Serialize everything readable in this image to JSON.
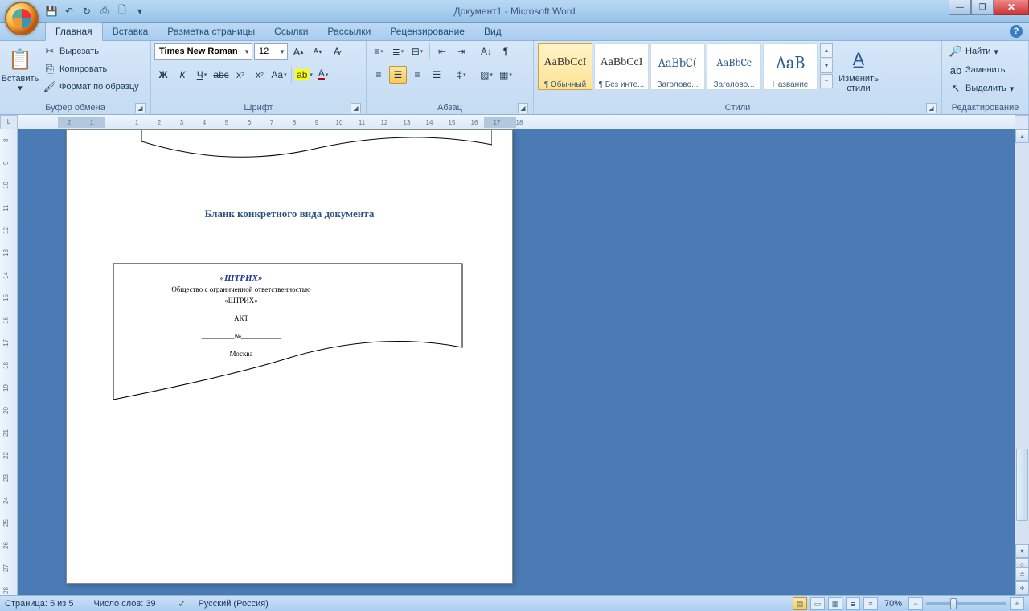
{
  "title": "Документ1 - Microsoft Word",
  "qat": {
    "save": "💾",
    "undo": "↶",
    "redo": "↻",
    "print": "⎙",
    "new": "🗋"
  },
  "tabs": [
    "Главная",
    "Вставка",
    "Разметка страницы",
    "Ссылки",
    "Рассылки",
    "Рецензирование",
    "Вид"
  ],
  "ribbon": {
    "clipboard": {
      "label": "Буфер обмена",
      "paste": "Вставить",
      "cut": "Вырезать",
      "copy": "Копировать",
      "format": "Формат по образцу"
    },
    "font": {
      "label": "Шрифт",
      "name": "Times New Roman",
      "size": "12"
    },
    "paragraph": {
      "label": "Абзац"
    },
    "styles": {
      "label": "Стили",
      "items": [
        {
          "name": "¶ Обычный",
          "preview": "AaBbCcI"
        },
        {
          "name": "¶ Без инте...",
          "preview": "AaBbCcI"
        },
        {
          "name": "Заголово...",
          "preview": "AaBbC("
        },
        {
          "name": "Заголово...",
          "preview": "AaBbCc"
        },
        {
          "name": "Название",
          "preview": "AaB"
        }
      ],
      "change": "Изменить\nстили"
    },
    "editing": {
      "label": "Редактирование",
      "find": "Найти",
      "replace": "Заменить",
      "select": "Выделить"
    }
  },
  "document": {
    "heading": "Бланк конкретного вида документа",
    "form": {
      "logo": "«ШТРИХ»",
      "org": "Общество с ограниченной ответственностью",
      "quoted": "«ШТРИХ»",
      "type": "АКТ",
      "numline": "_________№___________",
      "city": "Москва"
    }
  },
  "status": {
    "page": "Страница: 5 из 5",
    "words": "Число слов: 39",
    "lang": "Русский (Россия)",
    "zoom": "70%"
  },
  "ruler_numbers": [
    "2",
    "1",
    "",
    "1",
    "2",
    "3",
    "4",
    "5",
    "6",
    "7",
    "8",
    "9",
    "10",
    "11",
    "12",
    "13",
    "14",
    "15",
    "16",
    "17",
    "18"
  ]
}
